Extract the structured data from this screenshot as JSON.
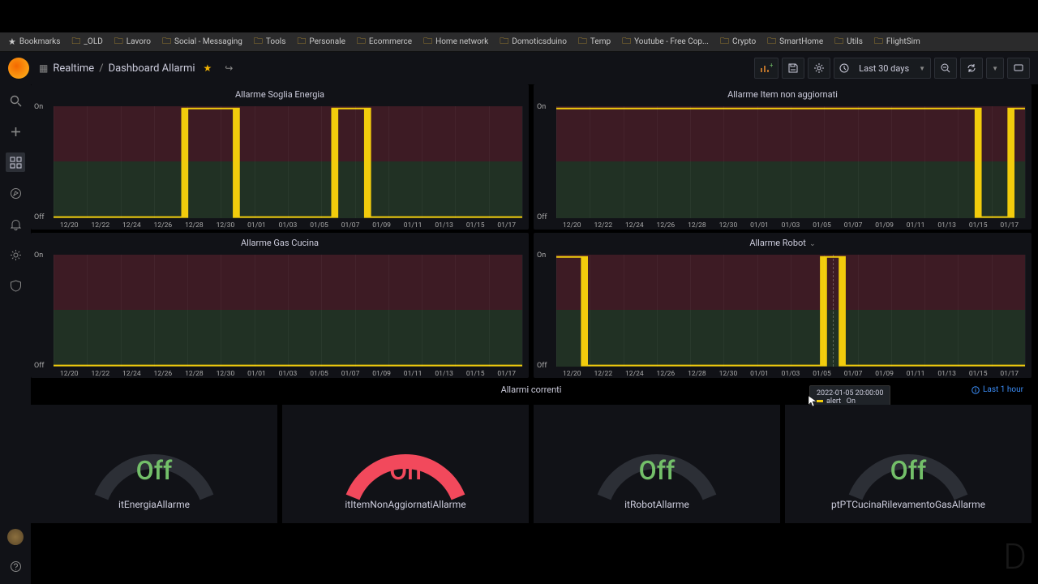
{
  "bookmarks": [
    "Bookmarks",
    "_OLD",
    "Lavoro",
    "Social - Messaging",
    "Tools",
    "Personale",
    "Ecommerce",
    "Home network",
    "Domoticsduino",
    "Temp",
    "Youtube - Free Cop...",
    "Crypto",
    "SmartHome",
    "Utils",
    "FlightSim"
  ],
  "breadcrumb": {
    "folder": "Realtime",
    "dashboard": "Dashboard Allarmi"
  },
  "header": {
    "timerange": "Last 30 days"
  },
  "panels": {
    "p1": {
      "title": "Allarme Soglia Energia"
    },
    "p2": {
      "title": "Allarme Item non aggiornati"
    },
    "p3": {
      "title": "Allarme Gas Cucina"
    },
    "p4": {
      "title": "Allarme Robot"
    }
  },
  "y": {
    "on": "On",
    "off": "Off"
  },
  "xticks": [
    "12/20",
    "12/22",
    "12/24",
    "12/26",
    "12/28",
    "12/30",
    "01/01",
    "01/03",
    "01/05",
    "01/07",
    "01/09",
    "01/11",
    "01/13",
    "01/15",
    "01/17"
  ],
  "tooltip": {
    "time": "2022-01-05 20:00:00",
    "series": "alert",
    "value": "On"
  },
  "section": {
    "title": "Allarmi correnti",
    "info": "Last 1 hour"
  },
  "gauges": {
    "g1": {
      "value": "Off",
      "label": "itEnergiaAllarme",
      "state": "off"
    },
    "g2": {
      "value": "On",
      "label": "itItemNonAggiornatiAllarme",
      "state": "on"
    },
    "g3": {
      "value": "Off",
      "label": "itRobotAllarme",
      "state": "off"
    },
    "g4": {
      "value": "Off",
      "label": "ptPTCucinaRilevamentoGasAllarme",
      "state": "off"
    }
  },
  "chart_data": [
    {
      "type": "line",
      "title": "Allarme Soglia Energia",
      "x": [
        "12/20",
        "12/28",
        "12/28",
        "12/31",
        "12/31",
        "01/06",
        "01/06",
        "01/08",
        "01/08",
        "01/17"
      ],
      "y": [
        0,
        0,
        1,
        1,
        0,
        0,
        1,
        1,
        0,
        0
      ],
      "ylabels": [
        "Off",
        "On"
      ],
      "series_name": "alert"
    },
    {
      "type": "line",
      "title": "Allarme Item non aggiornati",
      "x": [
        "12/20",
        "01/13",
        "01/13",
        "01/17",
        "01/17",
        "01/17"
      ],
      "y": [
        1,
        1,
        0,
        0,
        1,
        1
      ],
      "ylabels": [
        "Off",
        "On"
      ],
      "series_name": "alert"
    },
    {
      "type": "line",
      "title": "Allarme Gas Cucina",
      "x": [
        "12/20",
        "01/17"
      ],
      "y": [
        0,
        0
      ],
      "ylabels": [
        "Off",
        "On"
      ],
      "series_name": "alert"
    },
    {
      "type": "line",
      "title": "Allarme Robot",
      "x": [
        "12/20",
        "12/21",
        "12/21",
        "01/05",
        "01/05",
        "01/06",
        "01/06",
        "01/17"
      ],
      "y": [
        1,
        1,
        0,
        0,
        1,
        1,
        0,
        0
      ],
      "ylabels": [
        "Off",
        "On"
      ],
      "series_name": "alert"
    }
  ]
}
